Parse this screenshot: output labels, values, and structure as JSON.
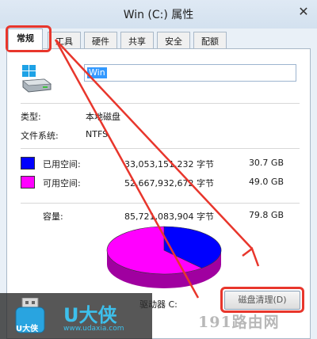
{
  "window": {
    "title": "Win (C:) 属性",
    "close_glyph": "✕"
  },
  "tabs": [
    {
      "label": "常规",
      "active": true
    },
    {
      "label": "工具",
      "active": false
    },
    {
      "label": "硬件",
      "active": false
    },
    {
      "label": "共享",
      "active": false
    },
    {
      "label": "安全",
      "active": false
    },
    {
      "label": "配额",
      "active": false
    }
  ],
  "drive": {
    "icon": "hard-drive-icon",
    "name_value": "Win"
  },
  "info": {
    "type_label": "类型:",
    "type_value": "本地磁盘",
    "fs_label": "文件系统:",
    "fs_value": "NTFS"
  },
  "space": {
    "used": {
      "label": "已用空间:",
      "bytes": "33,053,151,232 字节",
      "size": "30.7 GB",
      "color": "#0000ff"
    },
    "free": {
      "label": "可用空间:",
      "bytes": "52,667,932,672 字节",
      "size": "49.0 GB",
      "color": "#ff00ff"
    },
    "capacity": {
      "label": "容量:",
      "bytes": "85,721,083,904 字节",
      "size": "79.8 GB"
    }
  },
  "pie": {
    "used_gb": 30.7,
    "free_gb": 49.0
  },
  "drive_label": "驱动器 C:",
  "cleanup_button": "磁盘清理(D)",
  "annotation": {
    "highlight_color": "#e8362c"
  },
  "branding": {
    "logo_text": "U大侠",
    "logo_url": "www.udaxia.com",
    "icon_caption": "U大侠",
    "watermark": "191路由网"
  }
}
